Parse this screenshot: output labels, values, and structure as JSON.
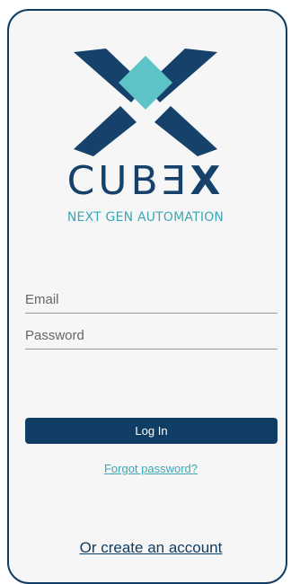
{
  "brand": {
    "name_prefix": "CUBƎ",
    "name_x": "X",
    "tagline": "NEXT GEN AUTOMATION",
    "colors": {
      "navy": "#0f3d63",
      "teal": "#5cc3c6"
    },
    "logo_icon": "cubex-x-logo-icon"
  },
  "login": {
    "email_placeholder": "Email",
    "password_placeholder": "Password",
    "login_label": "Log In",
    "forgot_label": "Forgot password?",
    "create_label": "Or create an account"
  }
}
